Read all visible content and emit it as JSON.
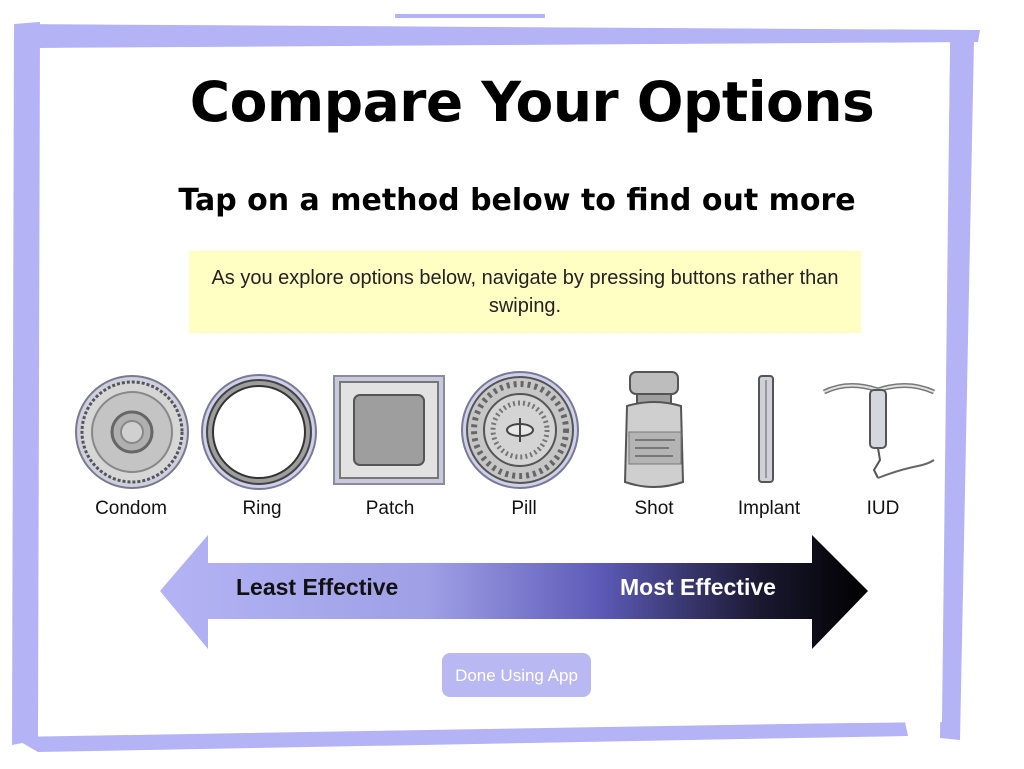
{
  "page": {
    "title": "Compare Your Options",
    "subtitle": "Tap on a method below to find out more",
    "notice": "As you explore options below, navigate by pressing buttons rather than swiping."
  },
  "methods": [
    {
      "label": "Condom",
      "icon": "condom-icon"
    },
    {
      "label": "Ring",
      "icon": "ring-icon"
    },
    {
      "label": "Patch",
      "icon": "patch-icon"
    },
    {
      "label": "Pill",
      "icon": "pill-icon"
    },
    {
      "label": "Shot",
      "icon": "shot-icon"
    },
    {
      "label": "Implant",
      "icon": "implant-icon"
    },
    {
      "label": "IUD",
      "icon": "iud-icon"
    }
  ],
  "effectiveness": {
    "least_label": "Least Effective",
    "most_label": "Most Effective"
  },
  "done_button": {
    "label": "Done Using App"
  },
  "colors": {
    "frame": "#b3b3f5",
    "notice_background": "#ffffc4",
    "button_background": "#b9b8f3",
    "arrow_start": "#b3b3f5",
    "arrow_end": "#000000"
  }
}
